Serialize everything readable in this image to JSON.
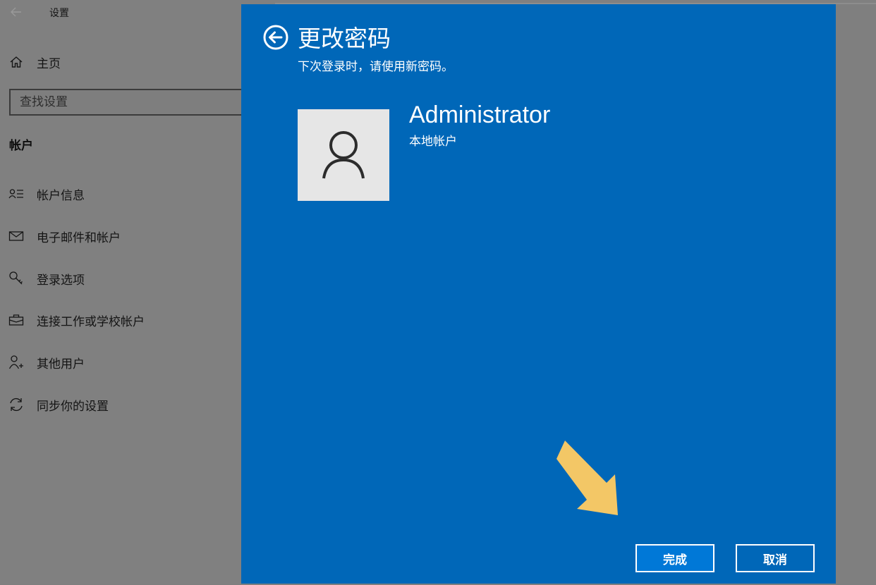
{
  "settings": {
    "window_title": "设置",
    "home_label": "主页",
    "search_placeholder": "查找设置",
    "section_heading": "帐户",
    "nav_items": [
      {
        "label": "帐户信息",
        "icon": "account-info-icon"
      },
      {
        "label": "电子邮件和帐户",
        "icon": "mail-icon"
      },
      {
        "label": "登录选项",
        "icon": "key-icon"
      },
      {
        "label": "连接工作或学校帐户",
        "icon": "briefcase-icon"
      },
      {
        "label": "其他用户",
        "icon": "person-add-icon"
      },
      {
        "label": "同步你的设置",
        "icon": "sync-icon"
      }
    ]
  },
  "dialog": {
    "title": "更改密码",
    "subtitle": "下次登录时，请使用新密码。",
    "account_name": "Administrator",
    "account_type": "本地帐户",
    "done_label": "完成",
    "cancel_label": "取消",
    "accent_color": "#0067b8",
    "button_highlight_color": "#0078d7",
    "pointer_arrow_color": "#f3c766"
  }
}
